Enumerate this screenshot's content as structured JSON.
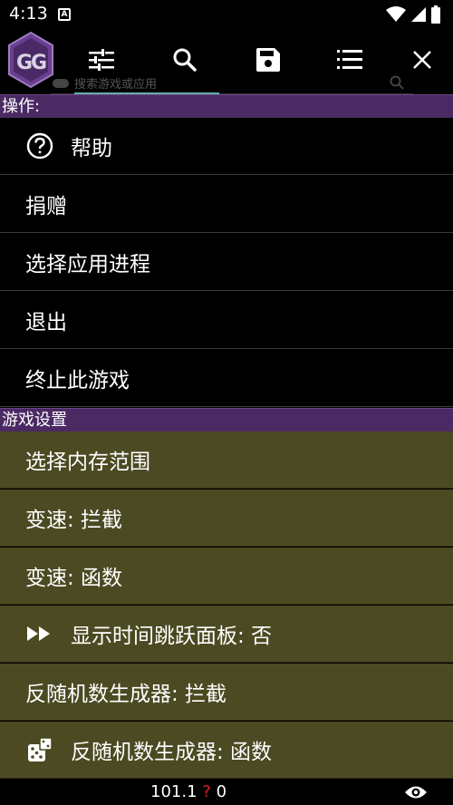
{
  "statusbar": {
    "time": "4:13",
    "notif_letter": "A"
  },
  "search": {
    "placeholder": "搜索游戏或应用"
  },
  "sections": {
    "operations": "操作:",
    "game_settings": "游戏设置"
  },
  "menu": {
    "help": "帮助",
    "donate": "捐赠",
    "select_process": "选择应用进程",
    "exit": "退出",
    "kill_game": "终止此游戏",
    "memory_range": "选择内存范围",
    "speed_intercept": "变速: 拦截",
    "speed_function": "变速: 函数",
    "time_jump_panel": "显示时间跳跃面板: 否",
    "rng_intercept": "反随机数生成器: 拦截",
    "rng_function": "反随机数生成器: 函数"
  },
  "bottombar": {
    "value": "101.1",
    "question": "?",
    "count": "0"
  },
  "colors": {
    "section_bg": "#4b2a63",
    "olive_bg": "#4b4a22",
    "accent": "#5fb1b0",
    "question": "#e02020"
  }
}
